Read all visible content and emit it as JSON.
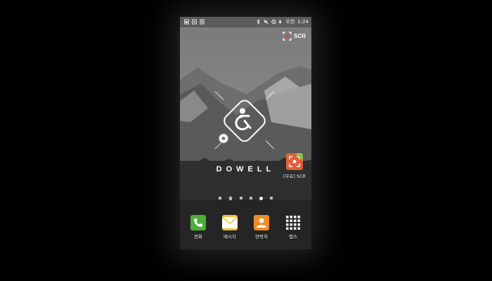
{
  "status_bar": {
    "left_icons": [
      "image-icon",
      "screen-record-icon",
      "document-icon"
    ],
    "right_icons": [
      "bluetooth-icon",
      "mute-icon",
      "no-disturb-icon",
      "battery-icon"
    ],
    "ampm": "오전",
    "time": "1:24"
  },
  "scr_overlay": {
    "label": "SCR",
    "icon": "record-target-icon"
  },
  "wallpaper": {
    "brand": "DOWELL",
    "colors": {
      "sky": "#8a8a8a",
      "mountain": "#555555",
      "forest": "#2e2e2e"
    }
  },
  "desktop_apps": [
    {
      "label": "[무료] SCR",
      "icon": "scr-app-icon",
      "badge": "FREE",
      "color": "#e0603a"
    }
  ],
  "pager": {
    "count": 6,
    "active": 4,
    "home": 1
  },
  "dock": [
    {
      "label": "전화",
      "icon": "phone-icon",
      "color": "#4caf36"
    },
    {
      "label": "메시지",
      "icon": "message-icon",
      "color": "#f2c230"
    },
    {
      "label": "연락처",
      "icon": "contacts-icon",
      "color": "#f08a24"
    },
    {
      "label": "앱스",
      "icon": "apps-grid-icon",
      "color": "#ffffff"
    }
  ]
}
